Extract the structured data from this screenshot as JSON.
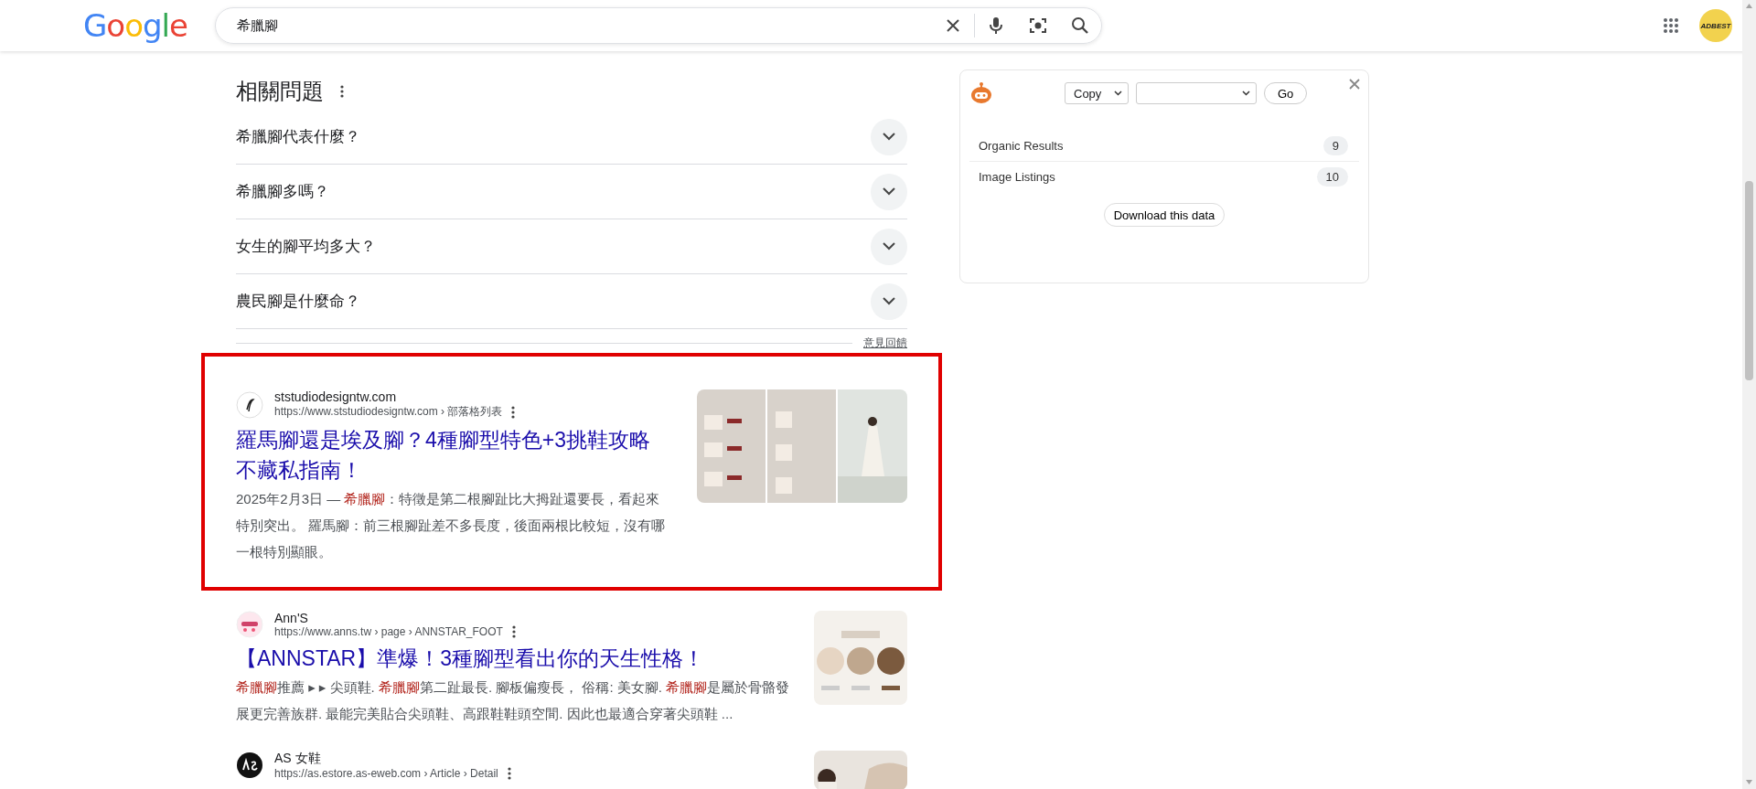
{
  "header": {
    "logo": "Google",
    "search": {
      "value": "希臘腳"
    },
    "avatar": "ADBEST"
  },
  "related_questions": {
    "title": "相關問題",
    "items": [
      {
        "text": "希臘腳代表什麼？",
        "expanded": false
      },
      {
        "text": "希臘腳多嗎？",
        "expanded": false
      },
      {
        "text": "女生的腳平均多大？",
        "expanded": false
      },
      {
        "text": "農民腳是什麼命？",
        "expanded": false
      }
    ],
    "feedback": "意見回饋"
  },
  "results": [
    {
      "site": "ststudiodesigntw.com",
      "url": "https://www.ststudiodesigntw.com › 部落格列表",
      "title": "羅馬腳還是埃及腳？4種腳型特色+3挑鞋攻略不藏私指南！",
      "highlighted": true,
      "snippet": [
        {
          "text": "2025年2月3日 — ",
          "highlight": false
        },
        {
          "text": "希臘腳",
          "highlight": true
        },
        {
          "text": "：特徵是第二根腳趾比大拇趾還要長，看起來特別突出。 羅馬腳：前三根腳趾差不多長度，後面兩根比較短，沒有哪一根特別顯眼。",
          "highlight": false
        }
      ]
    },
    {
      "site": "Ann'S",
      "url": "https://www.anns.tw › page › ANNSTAR_FOOT",
      "title": "【ANNSTAR】準爆！3種腳型看出你的天生性格！",
      "highlighted": false,
      "snippet": [
        {
          "text": "希臘腳",
          "highlight": true
        },
        {
          "text": "推薦 ▸ ▸ 尖頭鞋. ",
          "highlight": false
        },
        {
          "text": "希臘腳",
          "highlight": true
        },
        {
          "text": "第二趾最長. 腳板偏瘦長， 俗稱: 美女腳. ",
          "highlight": false
        },
        {
          "text": "希臘腳",
          "highlight": true
        },
        {
          "text": "是屬於骨骼發展更完善族群. 最能完美貼合尖頭鞋、高跟鞋鞋頭空間. 因此也最適合穿著尖頭鞋 ...",
          "highlight": false
        }
      ]
    },
    {
      "site": "AS 女鞋",
      "url": "https://as.estore.as-eweb.com › Article › Detail",
      "highlighted": false
    }
  ],
  "panel": {
    "action": "Copy",
    "rows": [
      {
        "label": "Organic Results",
        "count": "9"
      },
      {
        "label": "Image Listings",
        "count": "10"
      }
    ],
    "go": "Go",
    "download": "Download this data"
  }
}
